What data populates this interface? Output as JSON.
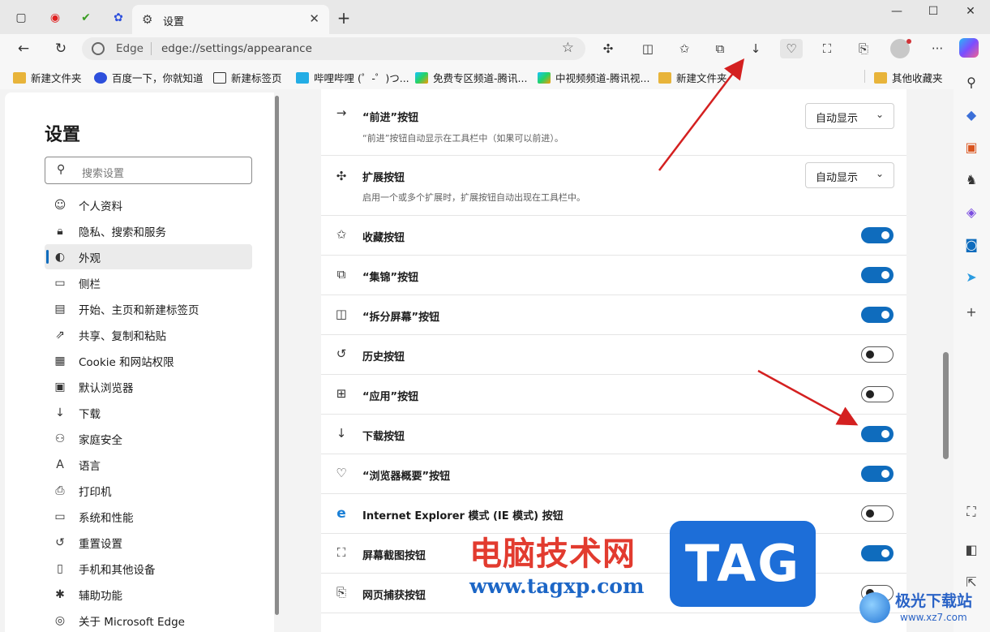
{
  "browser": {
    "tab_title": "设置",
    "new_tab": "+",
    "address": {
      "site_label": "Edge",
      "url": "edge://settings/appearance"
    },
    "favorites": [
      {
        "label": "新建文件夹",
        "icon": "folder"
      },
      {
        "label": "百度一下，你就知道",
        "icon": "baidu"
      },
      {
        "label": "新建标签页",
        "icon": "newtab"
      },
      {
        "label": "哔哩哔哩 (゜-゜)つ...",
        "icon": "bilibili"
      },
      {
        "label": "免费专区频道-腾讯...",
        "icon": "tencent-video"
      },
      {
        "label": "中视频频道-腾讯视...",
        "icon": "tencent-video"
      },
      {
        "label": "新建文件夹",
        "icon": "folder"
      }
    ],
    "other_favorites": "其他收藏夹"
  },
  "sidebar": {
    "title": "设置",
    "search_placeholder": "搜索设置",
    "items": [
      {
        "label": "个人资料",
        "icon": "profile-icon"
      },
      {
        "label": "隐私、搜索和服务",
        "icon": "lock-icon"
      },
      {
        "label": "外观",
        "icon": "palette-icon",
        "active": true
      },
      {
        "label": "侧栏",
        "icon": "sidebar-icon"
      },
      {
        "label": "开始、主页和新建标签页",
        "icon": "home-icon"
      },
      {
        "label": "共享、复制和粘贴",
        "icon": "share-icon"
      },
      {
        "label": "Cookie 和网站权限",
        "icon": "cookie-icon"
      },
      {
        "label": "默认浏览器",
        "icon": "browser-icon"
      },
      {
        "label": "下载",
        "icon": "download-icon"
      },
      {
        "label": "家庭安全",
        "icon": "family-icon"
      },
      {
        "label": "语言",
        "icon": "language-icon"
      },
      {
        "label": "打印机",
        "icon": "printer-icon"
      },
      {
        "label": "系统和性能",
        "icon": "laptop-icon"
      },
      {
        "label": "重置设置",
        "icon": "reset-icon"
      },
      {
        "label": "手机和其他设备",
        "icon": "phone-icon"
      },
      {
        "label": "辅助功能",
        "icon": "accessibility-icon"
      },
      {
        "label": "关于 Microsoft Edge",
        "icon": "edge-icon"
      }
    ]
  },
  "settings": {
    "forward_button": {
      "label": "“前进”按钮",
      "desc": "“前进”按钮自动显示在工具栏中（如果可以前进）。",
      "value": "自动显示"
    },
    "extensions_button": {
      "label": "扩展按钮",
      "desc": "启用一个或多个扩展时，扩展按钮自动出现在工具栏中。",
      "value": "自动显示"
    },
    "toggles": [
      {
        "label": "收藏按钮",
        "icon": "favorites-icon",
        "on": true
      },
      {
        "label": "“集锦”按钮",
        "icon": "collections-icon",
        "on": true
      },
      {
        "label": "“拆分屏幕”按钮",
        "icon": "split-screen-icon",
        "on": true
      },
      {
        "label": "历史按钮",
        "icon": "history-icon",
        "on": false
      },
      {
        "label": "“应用”按钮",
        "icon": "apps-icon",
        "on": false
      },
      {
        "label": "下载按钮",
        "icon": "download-icon",
        "on": true
      },
      {
        "label": "“浏览器概要”按钮",
        "icon": "heartbeat-icon",
        "on": true
      },
      {
        "label": "Internet Explorer 模式 (IE 模式) 按钮",
        "icon": "ie-icon",
        "on": false
      },
      {
        "label": "屏幕截图按钮",
        "icon": "screenshot-icon",
        "on": true
      },
      {
        "label": "网页捕获按钮",
        "icon": "web-capture-icon",
        "on": false
      }
    ]
  },
  "watermark": {
    "cn": "电脑技术网",
    "url": "www.tagxp.com",
    "tag": "TAG",
    "site_cn": "极光下载站",
    "site_url": "www.xz7.com"
  },
  "colors": {
    "accent": "#0f6cbd",
    "annotation_arrow": "#d42020"
  }
}
